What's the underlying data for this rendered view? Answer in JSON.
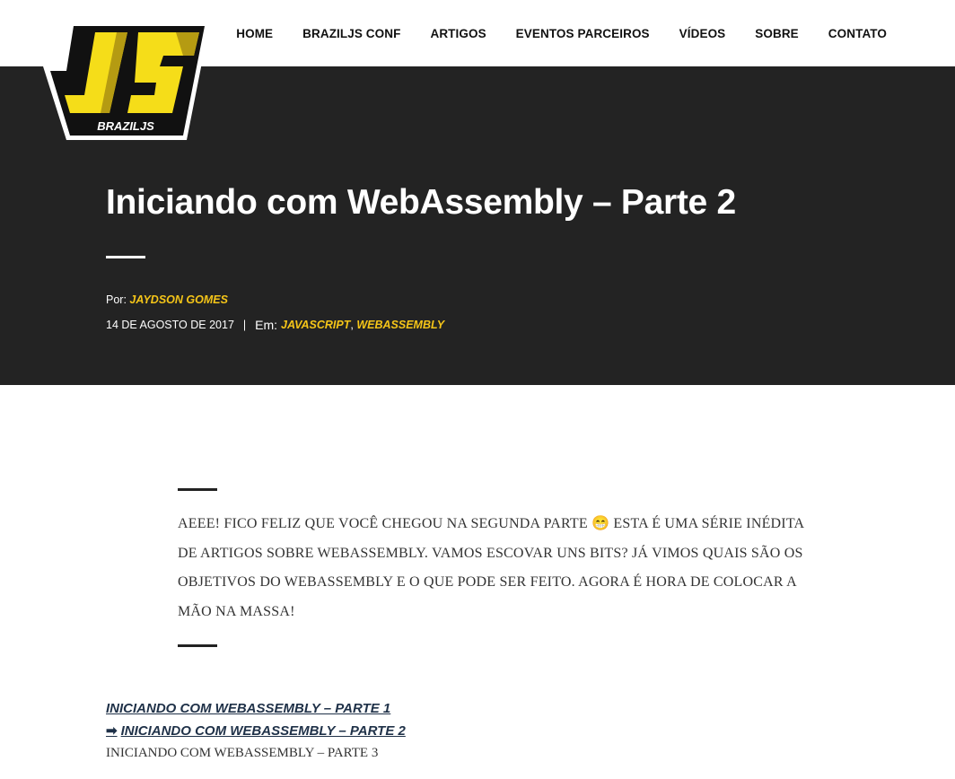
{
  "nav": {
    "items": [
      "HOME",
      "BRAZILJS CONF",
      "ARTIGOS",
      "EVENTOS PARCEIROS",
      "VÍDEOS",
      "SOBRE",
      "CONTATO"
    ]
  },
  "logo": {
    "letters": "JS",
    "caption": "BRAZILJS"
  },
  "colors": {
    "accent": "#f5c518",
    "hero_bg": "#232323",
    "link_dark": "#1f3148"
  },
  "post": {
    "title": "Iniciando com WebAssembly – Parte 2",
    "by_label": "Por:",
    "author": "JAYDSON GOMES",
    "date": "14 DE AGOSTO DE 2017",
    "separator": "|",
    "in_label": "Em:",
    "categories": [
      "JAVASCRIPT",
      "WEBASSEMBLY"
    ],
    "category_separator": ","
  },
  "intro": {
    "before_emoji": "AEEE! FICO FELIZ QUE VOCÊ CHEGOU NA SEGUNDA PARTE",
    "emoji": "😁",
    "after_emoji": "ESTA É UMA SÉRIE INÉDITA DE ARTIGOS SOBRE WEBASSEMBLY. VAMOS ESCOVAR UNS BITS? JÁ VIMOS QUAIS SÃO OS OBJETIVOS DO WEBASSEMBLY E O QUE PODE SER FEITO. AGORA É HORA DE COLOCAR A MÃO NA MASSA!"
  },
  "series": {
    "arrow": "➡",
    "items": [
      "INICIANDO COM WEBASSEMBLY – PARTE 1",
      "INICIANDO COM WEBASSEMBLY – PARTE 2",
      "INICIANDO COM WEBASSEMBLY – PARTE 3"
    ]
  }
}
